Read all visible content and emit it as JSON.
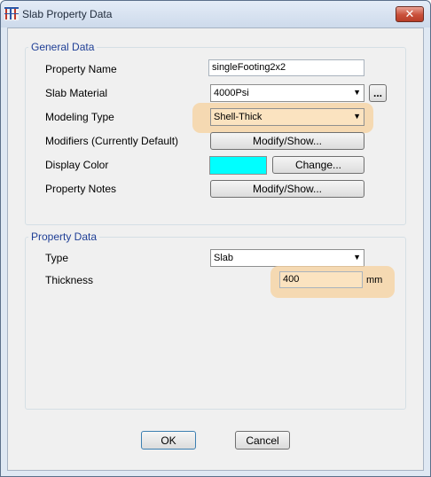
{
  "window": {
    "title": "Slab Property Data",
    "close_symbol": "✕",
    "icon": "app-icon"
  },
  "general_data": {
    "legend": "General Data",
    "property_name_label": "Property Name",
    "property_name_value": "singleFooting2x2",
    "slab_material_label": "Slab Material",
    "slab_material_value": "4000Psi",
    "slab_material_browse": "...",
    "modeling_type_label": "Modeling Type",
    "modeling_type_value": "Shell-Thick",
    "modifiers_label": "Modifiers (Currently Default)",
    "modifiers_button": "Modify/Show...",
    "display_color_label": "Display Color",
    "display_color_value": "#00ffff",
    "display_color_button": "Change...",
    "property_notes_label": "Property Notes",
    "property_notes_button": "Modify/Show..."
  },
  "property_data": {
    "legend": "Property Data",
    "type_label": "Type",
    "type_value": "Slab",
    "thickness_label": "Thickness",
    "thickness_value": "400",
    "thickness_unit": "mm"
  },
  "buttons": {
    "ok": "OK",
    "cancel": "Cancel"
  },
  "colors": {
    "highlight": "#f7d29d",
    "legend_text": "#1f3f96",
    "close_button": "#c9503a"
  }
}
